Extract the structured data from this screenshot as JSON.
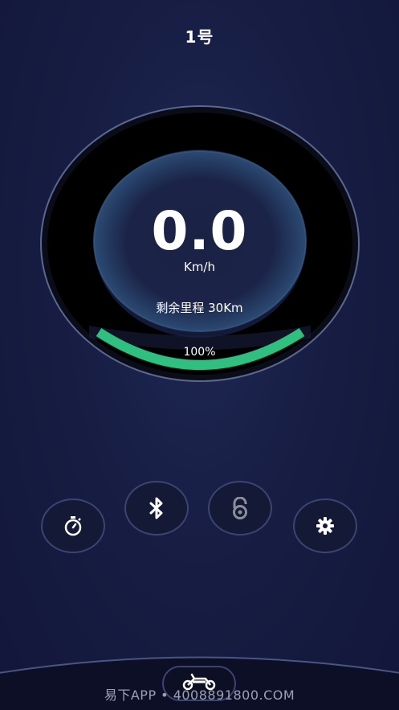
{
  "header": {
    "title": "1号"
  },
  "dashboard": {
    "speed": "0.0",
    "speed_unit": "Km/h",
    "remaining_range_label": "剩余里程 30Km",
    "battery_percent_label": "100%",
    "battery_level": 1.0
  },
  "controls": [
    {
      "icon": "stopwatch-icon"
    },
    {
      "icon": "bluetooth-icon"
    },
    {
      "icon": "unlock-icon"
    },
    {
      "icon": "gear-icon"
    }
  ],
  "bottom_nav": {
    "center_icon": "scooter-icon"
  },
  "watermark": "易下APP • 4008891800.COM",
  "colors": {
    "background": "#15183a",
    "battery_arc": "#2fbf7f",
    "ring_border": "#5a6890",
    "button_border": "#3a4570"
  }
}
